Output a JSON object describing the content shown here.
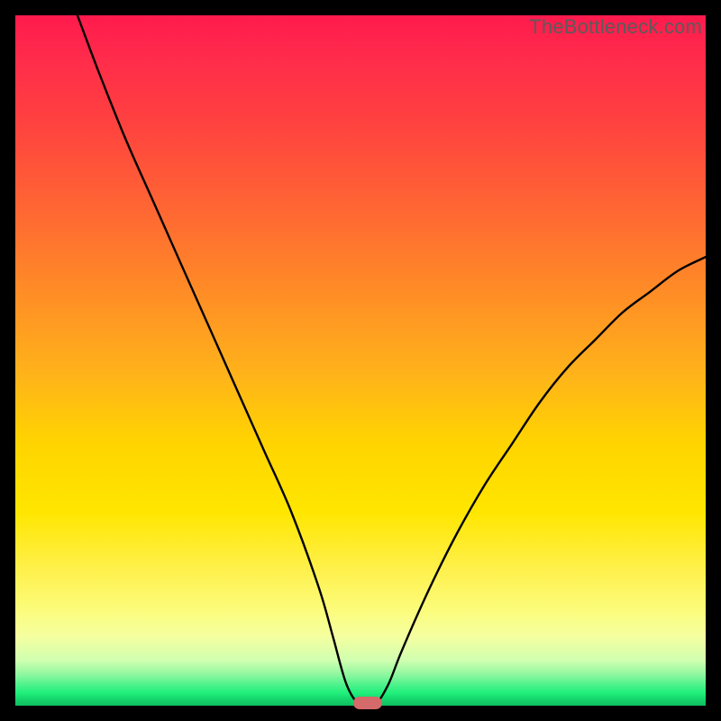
{
  "watermark": "TheBottleneck.com",
  "colors": {
    "frame_bg": "#000000",
    "gradient_top": "#ff1a4d",
    "gradient_bottom": "#0fbe5f",
    "curve_stroke": "#000000",
    "marker_fill": "#d46a6a",
    "watermark_text": "#5b5b5b"
  },
  "chart_data": {
    "type": "line",
    "title": "",
    "xlabel": "",
    "ylabel": "",
    "xlim": [
      0,
      100
    ],
    "ylim": [
      0,
      100
    ],
    "grid": false,
    "legend": false,
    "series": [
      {
        "name": "bottleneck-curve",
        "x": [
          9,
          12,
          16,
          20,
          24,
          28,
          32,
          36,
          40,
          44,
          46,
          48,
          50,
          52,
          54,
          56,
          60,
          64,
          68,
          72,
          76,
          80,
          84,
          88,
          92,
          96,
          100
        ],
        "y": [
          100,
          92,
          82,
          73,
          64,
          55,
          46,
          37,
          28,
          17,
          10,
          3,
          0,
          0,
          3,
          8,
          17,
          25,
          32,
          38,
          44,
          49,
          53,
          57,
          60,
          63,
          65
        ]
      }
    ],
    "marker": {
      "x": 51,
      "y": 0,
      "shape": "pill",
      "color": "#d46a6a"
    }
  }
}
